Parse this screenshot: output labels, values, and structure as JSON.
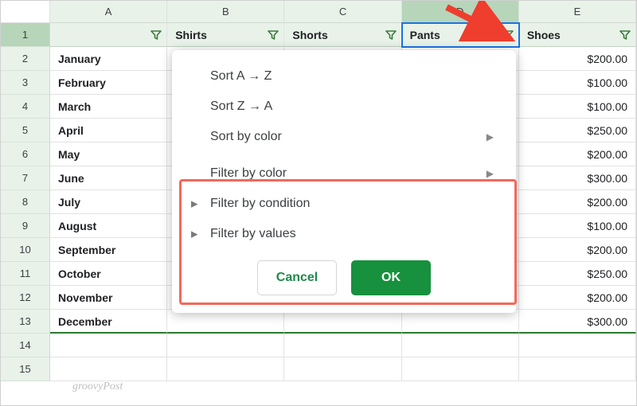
{
  "columns": [
    "A",
    "B",
    "C",
    "D",
    "E"
  ],
  "headerRow": {
    "A": "",
    "B": "Shirts",
    "C": "Shorts",
    "D": "Pants",
    "E": "Shoes"
  },
  "rows": [
    {
      "num": "2",
      "A": "January",
      "E": "$200.00"
    },
    {
      "num": "3",
      "A": "February",
      "E": "$100.00"
    },
    {
      "num": "4",
      "A": "March",
      "E": "$100.00"
    },
    {
      "num": "5",
      "A": "April",
      "E": "$250.00"
    },
    {
      "num": "6",
      "A": "May",
      "E": "$200.00"
    },
    {
      "num": "7",
      "A": "June",
      "E": "$300.00"
    },
    {
      "num": "8",
      "A": "July",
      "E": "$200.00"
    },
    {
      "num": "9",
      "A": "August",
      "E": "$100.00"
    },
    {
      "num": "10",
      "A": "September",
      "E": "$200.00"
    },
    {
      "num": "11",
      "A": "October",
      "E": "$250.00"
    },
    {
      "num": "12",
      "A": "November",
      "E": "$200.00"
    },
    {
      "num": "13",
      "A": "December",
      "E": "$300.00"
    },
    {
      "num": "14",
      "A": "",
      "E": ""
    },
    {
      "num": "15",
      "A": "",
      "E": ""
    }
  ],
  "menu": {
    "sortAZ": "Sort A → Z",
    "sortZA": "Sort Z → A",
    "sortColor": "Sort by color",
    "filterColor": "Filter by color",
    "filterCondition": "Filter by condition",
    "filterValues": "Filter by values",
    "cancel": "Cancel",
    "ok": "OK"
  },
  "watermark": "groovyPost",
  "rowHeader1": "1"
}
